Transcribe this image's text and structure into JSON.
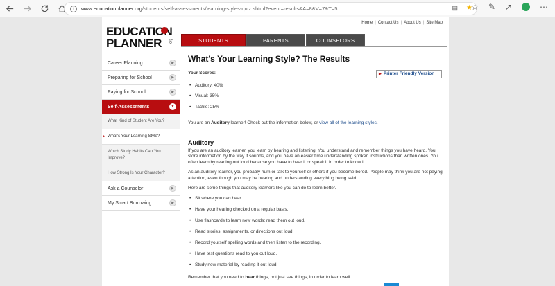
{
  "browser": {
    "url_host": "www.educationplanner.org",
    "url_path": "/students/self-assessments/learning-styles-quiz.shtml?event=results&A=8&V=7&T=5"
  },
  "brand": {
    "line1": "EDUCATION",
    "line2": "PLANNER",
    "suffix": ".org",
    "accent": "#b80d10"
  },
  "utility_links": [
    "Home",
    "Contact Us",
    "About Us",
    "Site Map"
  ],
  "tabs": [
    "STUDENTS",
    "PARENTS",
    "COUNSELORS"
  ],
  "sidebar": {
    "items": [
      {
        "label": "Career Planning"
      },
      {
        "label": "Preparing for School"
      },
      {
        "label": "Paying for School"
      },
      {
        "label": "Self-Assessments"
      }
    ],
    "sub_items": [
      {
        "label": "What Kind of Student Are You?"
      },
      {
        "label": "What's Your Learning Style?"
      },
      {
        "label": "Which Study Habits Can You Improve?"
      },
      {
        "label": "How Strong Is Your Character?"
      }
    ],
    "bottom_items": [
      {
        "label": "Ask a Counselor"
      },
      {
        "label": "My Smart Borrowing"
      }
    ]
  },
  "main": {
    "title": "What's Your Learning Style? The Results",
    "scores_heading": "Your Scores:",
    "printer_label": "Printer Friendly Version",
    "scores": [
      "Auditory: 40%",
      "Visual: 35%",
      "Tactile: 25%"
    ],
    "result_prefix": "You are an ",
    "result_style": "Auditory",
    "result_mid": " learner! Check out the information below, or ",
    "result_link": "view all of the learning styles",
    "result_end": ".",
    "section_heading": "Auditory",
    "para1": "If you are an auditory learner, you learn by hearing and listening. You understand and remember things you have heard. You store information by the way it sounds, and you have an easier time understanding spoken instructions than written ones. You often learn by reading out loud because you have to hear it or speak it in order to know it.",
    "para2": "As an auditory learner, you probably hum or talk to yourself or others if you become bored. People may think you are not paying attention, even though you may be hearing and understanding everything being said.",
    "para3": "Here are some things that auditory learners like you can do to learn better.",
    "tips": [
      "Sit where you can hear.",
      "Have your hearing checked on a regular basis.",
      "Use flashcards to learn new words; read them out loud.",
      "Read stories, assignments, or directions out loud.",
      "Record yourself spelling words and then listen to the recording.",
      "Have test questions read to you out loud.",
      "Study new material by reading it out loud."
    ],
    "remember_prefix": "Remember that you need to ",
    "remember_bold": "hear",
    "remember_suffix": " things, not just see things, in order to learn well."
  }
}
